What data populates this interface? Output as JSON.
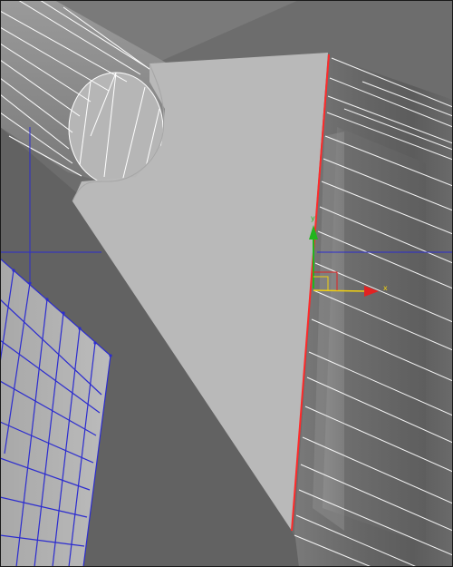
{
  "viewport": {
    "background_color": "#6e6e6e",
    "wire_color": "#ffffff",
    "selected_edge_color": "#ff2a2a",
    "grid_color": "#2c2ccf",
    "mesh_face_color": "#b9b9b9",
    "gizmo_y_color": "#22b51d",
    "gizmo_x_color": "#e22222",
    "gizmo_z_color": "#f0d010"
  },
  "gizmo": {
    "x_axis_label": "x",
    "y_axis_label": "y",
    "x_axis_icon": "arrow-right-icon",
    "y_axis_icon": "arrow-up-icon"
  }
}
